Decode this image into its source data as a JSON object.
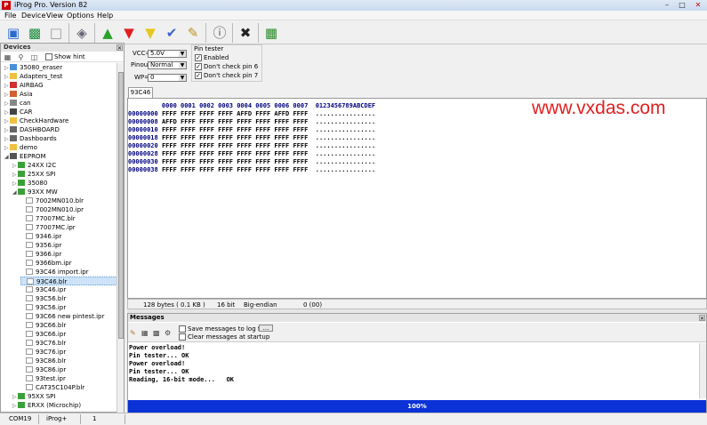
{
  "window": {
    "title": "iProg Pro. Version 82",
    "app_icon_text": "P"
  },
  "menu": [
    "File",
    "Device",
    "View",
    "Options",
    "Help"
  ],
  "toolbar": [
    "open-icon",
    "save-icon",
    "new-icon",
    "erase-icon",
    "write-up-icon",
    "read-down-icon",
    "verify-down-icon",
    "check-icon",
    "clean-icon",
    "info-icon",
    "stop-icon",
    "calc-icon"
  ],
  "devices": {
    "header": "Devices",
    "show_hint": "Show hint",
    "items": [
      {
        "label": "35080_eraser",
        "level": 0,
        "icon": "chip-icon"
      },
      {
        "label": "Adapters_test",
        "level": 0,
        "icon": "folder-icon"
      },
      {
        "label": "AIRBAG",
        "level": 0,
        "icon": "airbag-icon"
      },
      {
        "label": "Asia",
        "level": 0,
        "icon": "asia-icon"
      },
      {
        "label": "can",
        "level": 0,
        "icon": "can-icon"
      },
      {
        "label": "CAR",
        "level": 0,
        "icon": "car-icon"
      },
      {
        "label": "CheckHardware",
        "level": 0,
        "icon": "folder-icon"
      },
      {
        "label": "DASHBOARD",
        "level": 0,
        "icon": "dashboard-icon"
      },
      {
        "label": "Dashboards",
        "level": 0,
        "icon": "dashboard-icon"
      },
      {
        "label": "demo",
        "level": 0,
        "icon": "folder-icon"
      },
      {
        "label": "EEPROM",
        "level": 0,
        "icon": "eeprom-icon",
        "expanded": true
      },
      {
        "label": "24XX I2C",
        "level": 1,
        "icon": "green-chip-icon"
      },
      {
        "label": "25XX SPI",
        "level": 1,
        "icon": "green-chip-icon"
      },
      {
        "label": "35080",
        "level": 1,
        "icon": "green-chip-icon"
      },
      {
        "label": "93XX MW",
        "level": 1,
        "icon": "green-chip-icon",
        "expanded": true
      },
      {
        "label": "7002MN010.blr",
        "level": 2,
        "icon": "file-icon"
      },
      {
        "label": "7002MN010.ipr",
        "level": 2,
        "icon": "file-icon"
      },
      {
        "label": "77007MC.blr",
        "level": 2,
        "icon": "file-icon"
      },
      {
        "label": "77007MC.ipr",
        "level": 2,
        "icon": "file-icon"
      },
      {
        "label": "9346.ipr",
        "level": 2,
        "icon": "file-icon"
      },
      {
        "label": "9356.ipr",
        "level": 2,
        "icon": "file-icon"
      },
      {
        "label": "9366.ipr",
        "level": 2,
        "icon": "file-icon"
      },
      {
        "label": "9366bm.ipr",
        "level": 2,
        "icon": "file-icon"
      },
      {
        "label": "93C46 import.ipr",
        "level": 2,
        "icon": "file-icon"
      },
      {
        "label": "93C46.blr",
        "level": 2,
        "icon": "file-icon",
        "selected": true
      },
      {
        "label": "93C46.ipr",
        "level": 2,
        "icon": "file-icon"
      },
      {
        "label": "93C56.blr",
        "level": 2,
        "icon": "file-icon"
      },
      {
        "label": "93C56.ipr",
        "level": 2,
        "icon": "file-icon"
      },
      {
        "label": "93C66 new pintest.ipr",
        "level": 2,
        "icon": "file-icon"
      },
      {
        "label": "93C66.blr",
        "level": 2,
        "icon": "file-icon"
      },
      {
        "label": "93C66.ipr",
        "level": 2,
        "icon": "file-icon"
      },
      {
        "label": "93C76.blr",
        "level": 2,
        "icon": "file-icon"
      },
      {
        "label": "93C76.ipr",
        "level": 2,
        "icon": "file-icon"
      },
      {
        "label": "93C86.blr",
        "level": 2,
        "icon": "file-icon"
      },
      {
        "label": "93C86.ipr",
        "level": 2,
        "icon": "file-icon"
      },
      {
        "label": "93test.ipr",
        "level": 2,
        "icon": "file-icon"
      },
      {
        "label": "CAT35C104P.blr",
        "level": 2,
        "icon": "file-icon"
      },
      {
        "label": "95XX SPI",
        "level": 1,
        "icon": "green-chip-icon"
      },
      {
        "label": "ERXX (Microchip)",
        "level": 1,
        "icon": "green-chip-icon"
      }
    ]
  },
  "settings": {
    "vcc_label": "VCC=",
    "vcc_value": "5.0V",
    "pinout_label": "Pinout",
    "pinout_value": "Normal",
    "wp_label": "WP=",
    "wp_value": "0",
    "pin_tester_label": "Pin tester",
    "enabled_label": "Enabled",
    "pin6_label": "Don't check pin 6",
    "pin7_label": "Don't check pin 7"
  },
  "tab": {
    "label": "93C46"
  },
  "hex": {
    "header": "         0000 0001 0002 0003 0004 0005 0006 0007  0123456789ABCDEF",
    "rows": [
      {
        "addr": "00000000",
        "data": "FFFF FFFF FFFF FFFF AFFD FFFF AFFD FFFF",
        "ascii": "................"
      },
      {
        "addr": "00000008",
        "data": "AFFD FFFF FFFF FFFF FFFF FFFF FFFF FFFF",
        "ascii": "................"
      },
      {
        "addr": "00000010",
        "data": "FFFF FFFF FFFF FFFF FFFF FFFF FFFF FFFF",
        "ascii": "................"
      },
      {
        "addr": "00000018",
        "data": "FFFF FFFF FFFF FFFF FFFF FFFF FFFF FFFF",
        "ascii": "................"
      },
      {
        "addr": "00000020",
        "data": "FFFF FFFF FFFF FFFF FFFF FFFF FFFF FFFF",
        "ascii": "................"
      },
      {
        "addr": "00000028",
        "data": "FFFF FFFF FFFF FFFF FFFF FFFF FFFF FFFF",
        "ascii": "................"
      },
      {
        "addr": "00000030",
        "data": "FFFF FFFF FFFF FFFF FFFF FFFF FFFF FFFF",
        "ascii": "................"
      },
      {
        "addr": "00000038",
        "data": "FFFF FFFF FFFF FFFF FFFF FFFF FFFF FFFF",
        "ascii": "................"
      }
    ]
  },
  "watermark": "www.vxdas.com",
  "hex_status": {
    "size": "128 bytes ( 0.1 KB )",
    "bits": "16 bit",
    "endian": "Big-endian",
    "pos": "0 (00)"
  },
  "messages": {
    "header": "Messages",
    "save_log": "Save messages to log fi",
    "browse": "...",
    "clear_startup": "Clear messages at startup",
    "lines": [
      "Power overload!",
      "Pin tester... OK",
      "Power overload!",
      "Pin tester... OK",
      "Reading, 16-bit mode...   OK"
    ],
    "progress": "100%",
    "progress_value": 100
  },
  "status": {
    "port": "COM19",
    "device": "iProg+",
    "count": "1"
  }
}
